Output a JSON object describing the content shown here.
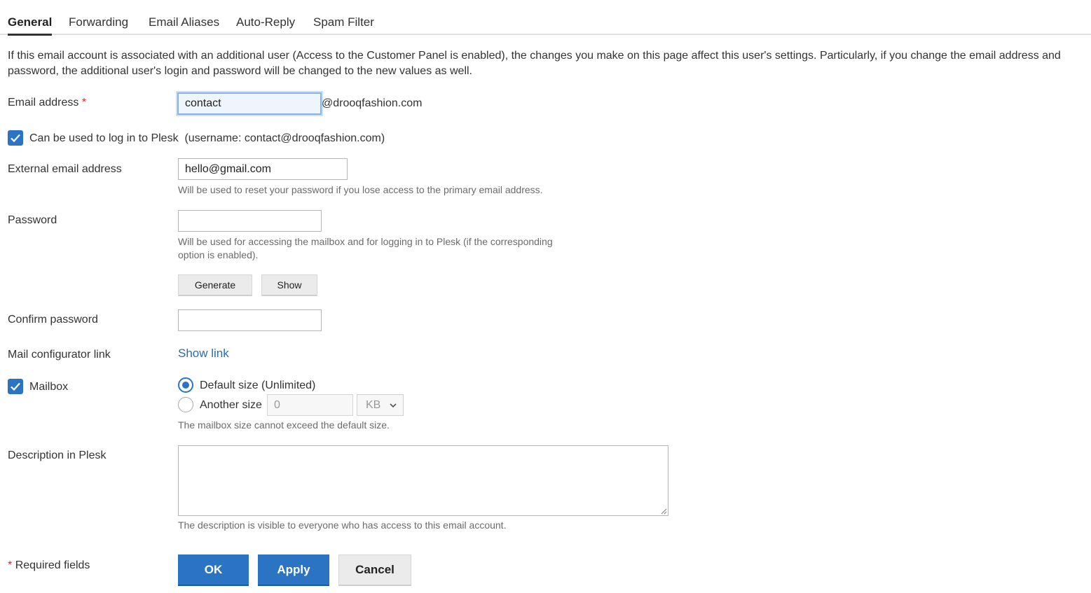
{
  "tabs": [
    {
      "label": "General",
      "active": true
    },
    {
      "label": "Forwarding",
      "active": false
    },
    {
      "label": "Email Aliases",
      "active": false
    },
    {
      "label": "Auto-Reply",
      "active": false
    },
    {
      "label": "Spam Filter",
      "active": false
    }
  ],
  "notice": "If this email account is associated with an additional user (Access to the Customer Panel is enabled), the changes you make on this page affect this user's settings. Particularly, if you change the email address and password, the additional user's login and password will be changed to the new values as well.",
  "email": {
    "label": "Email address",
    "required_mark": "*",
    "value": "contact",
    "domain_suffix": "@drooqfashion.com"
  },
  "login": {
    "checked": true,
    "label": "Can be used to log in to Plesk",
    "username_note": "(username: contact@drooqfashion.com)"
  },
  "external_email": {
    "label": "External email address",
    "value": "hello@gmail.com",
    "hint": "Will be used to reset your password if you lose access to the primary email address."
  },
  "password": {
    "label": "Password",
    "value": "",
    "hint_line1": "Will be used for accessing the mailbox and for logging in to Plesk (if the corresponding",
    "hint_line2": "option is enabled).",
    "generate_label": "Generate",
    "show_label": "Show"
  },
  "confirm_password": {
    "label": "Confirm password",
    "value": ""
  },
  "mail_configurator": {
    "label": "Mail configurator link",
    "link_text": "Show link"
  },
  "mailbox": {
    "checked": true,
    "label": "Mailbox",
    "default_option": "Default size (Unlimited)",
    "another_option": "Another size",
    "size_value": "0",
    "unit": "KB",
    "hint": "The mailbox size cannot exceed the default size."
  },
  "description": {
    "label": "Description in Plesk",
    "value": "",
    "hint": "The description is visible to everyone who has access to this email account."
  },
  "footer": {
    "required_mark": "*",
    "required_note": "Required fields",
    "ok_label": "OK",
    "apply_label": "Apply",
    "cancel_label": "Cancel"
  },
  "colors": {
    "accent": "#2b74c4",
    "required": "#d02c2c",
    "link": "#2b6cb0"
  }
}
